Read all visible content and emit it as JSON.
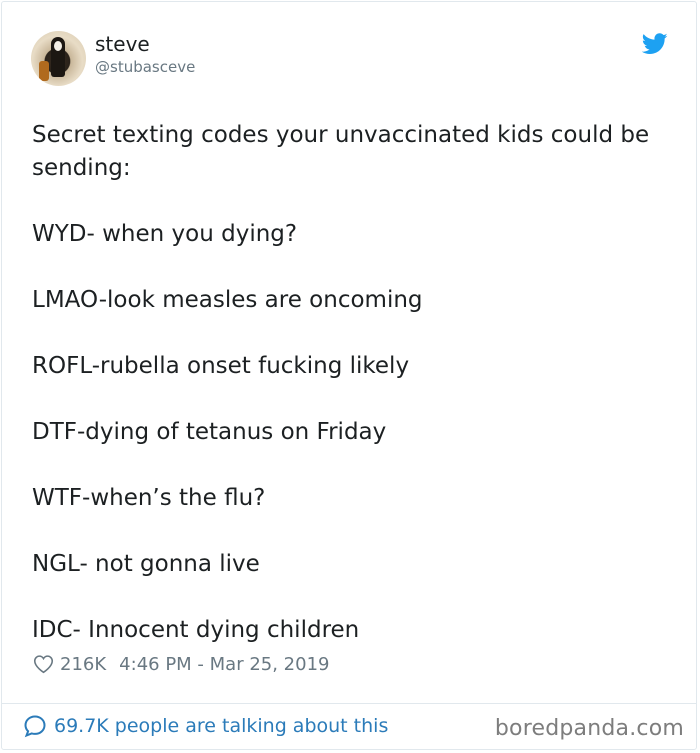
{
  "author": {
    "name": "steve",
    "handle": "@stubasceve",
    "avatar_icon": "avatar-photo"
  },
  "tweet": {
    "paragraphs": [
      "Secret texting codes your unvaccinated kids could be sending:",
      "WYD- when you dying?",
      "LMAO-look measles are oncoming",
      "ROFL-rubella onset fucking likely",
      "DTF-dying of tetanus on Friday",
      "WTF-when’s the flu?",
      "NGL- not gonna live",
      "IDC- Innocent dying children"
    ],
    "likes": "216K",
    "timestamp": "4:46 PM - Mar 25, 2019"
  },
  "footer": {
    "talking": "69.7K people are talking about this",
    "watermark": "boredpanda.com"
  },
  "colors": {
    "twitter_blue": "#1da1f2",
    "link_blue": "#2b7bb9",
    "text": "#1c2022",
    "muted": "#697882"
  },
  "icons": {
    "brand": "twitter-bird-icon",
    "like": "heart-icon",
    "reply": "speech-bubble-icon"
  }
}
